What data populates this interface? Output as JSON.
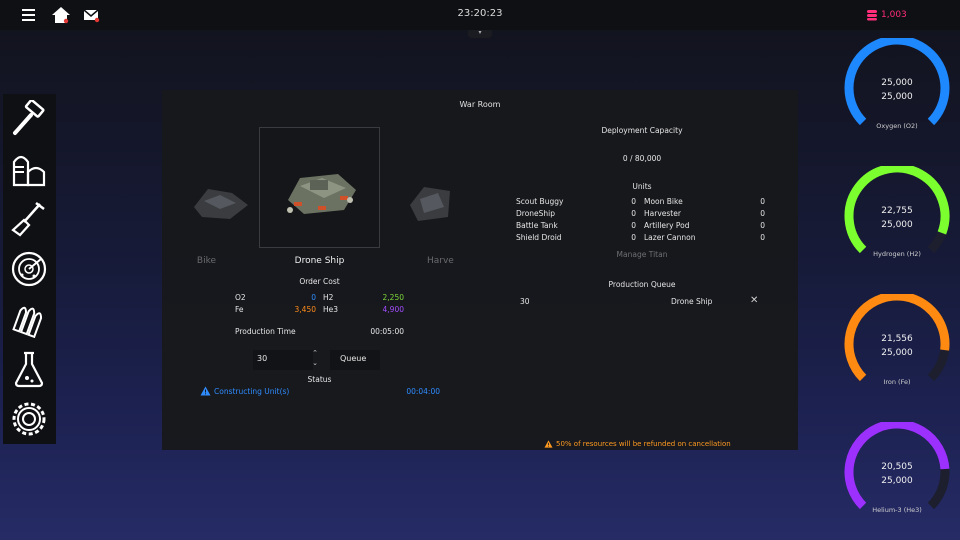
{
  "topbar": {
    "clock": "23:20:23",
    "gems": "1,003",
    "colors": {
      "gems": "#ff2d7a",
      "mail_dot": "#e53935"
    }
  },
  "sidebar": {
    "icons": [
      "hammer-icon",
      "silo-icon",
      "shovel-icon",
      "radar-icon",
      "ammo-icon",
      "flask-icon",
      "gear-icon"
    ]
  },
  "panel": {
    "title": "War Room",
    "carousel": {
      "left_label": "Bike",
      "center_label": "Drone Ship",
      "right_label": "Harve"
    },
    "order_cost": {
      "heading": "Order Cost",
      "items": [
        {
          "label": "O2",
          "value": "0",
          "color": "#2f8cff"
        },
        {
          "label": "H2",
          "value": "2,250",
          "color": "#7cd63a"
        },
        {
          "label": "Fe",
          "value": "3,450",
          "color": "#ff8a1a"
        },
        {
          "label": "He3",
          "value": "4,900",
          "color": "#a24dff"
        }
      ]
    },
    "production_time": {
      "label": "Production Time",
      "value": "00:05:00"
    },
    "quantity": "30",
    "queue_label": "Queue",
    "status": {
      "heading": "Status",
      "text": "Constructing Unit(s)",
      "time": "00:04:00",
      "color": "#2f8cff"
    },
    "deployment": {
      "heading": "Deployment Capacity",
      "value": "0 / 80,000"
    },
    "units": {
      "heading": "Units",
      "left": [
        {
          "name": "Scout Buggy",
          "count": "0"
        },
        {
          "name": "DroneShip",
          "count": "0"
        },
        {
          "name": "Battle Tank",
          "count": "0"
        },
        {
          "name": "Shield Droid",
          "count": "0"
        }
      ],
      "right": [
        {
          "name": "Moon Bike",
          "count": "0"
        },
        {
          "name": "Harvester",
          "count": "0"
        },
        {
          "name": "Artillery Pod",
          "count": "0"
        },
        {
          "name": "Lazer Cannon",
          "count": "0"
        }
      ]
    },
    "manage_titan": "Manage Titan",
    "production_queue": {
      "heading": "Production Queue",
      "rows": [
        {
          "qty": "30",
          "unit": "Drone Ship"
        }
      ]
    },
    "refund_notice": "50% of resources will be refunded on cancellation",
    "refund_color": "#ff9a1f"
  },
  "resources": [
    {
      "current": "25,000",
      "max": "25,000",
      "label": "Oxygen (O2)",
      "fraction": 1.0,
      "color": "#1e88ff"
    },
    {
      "current": "22,755",
      "max": "25,000",
      "label": "Hydrogen (H2)",
      "fraction": 0.91,
      "color": "#7cff2e"
    },
    {
      "current": "21,556",
      "max": "25,000",
      "label": "Iron (Fe)",
      "fraction": 0.86,
      "color": "#ff8a12"
    },
    {
      "current": "20,505",
      "max": "25,000",
      "label": "Helium-3 (He3)",
      "fraction": 0.82,
      "color": "#9b30ff"
    }
  ]
}
